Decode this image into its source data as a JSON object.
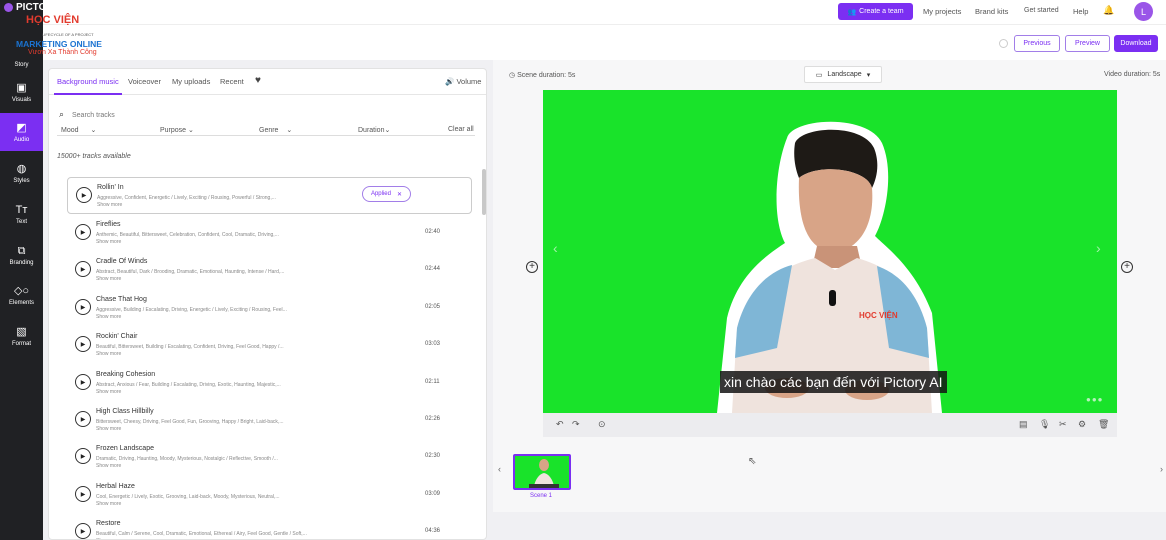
{
  "brand": {
    "logo_text": "PICTORY",
    "logo_sub": "LIFECYCLE OF A PROJECT",
    "watermark_line1": "HỌC VIỆN",
    "watermark_line2": "MARKETING ONLINE",
    "watermark_line3": "Vươn Xa Thành Công"
  },
  "rail": {
    "items": [
      {
        "label": "Story",
        "icon": "story-icon"
      },
      {
        "label": "Visuals",
        "icon": "image-icon"
      },
      {
        "label": "Audio",
        "icon": "music-icon"
      },
      {
        "label": "Styles",
        "icon": "palette-icon"
      },
      {
        "label": "Text",
        "icon": "text-icon"
      },
      {
        "label": "Branding",
        "icon": "branding-icon"
      },
      {
        "label": "Elements",
        "icon": "shapes-icon"
      },
      {
        "label": "Format",
        "icon": "format-icon"
      }
    ],
    "active": "Audio"
  },
  "topbar": {
    "create_team": "Create a team",
    "my_projects": "My projects",
    "brand_kits": "Brand kits",
    "get_started": "Get started",
    "help": "Help",
    "avatar_letter": "L"
  },
  "subbar": {
    "previous": "Previous",
    "preview": "Preview",
    "download": "Download"
  },
  "audio": {
    "tabs": [
      "Background music",
      "Voiceover",
      "My uploads",
      "Recent"
    ],
    "volume": "Volume",
    "search_placeholder": "Search tracks",
    "filters": [
      "Mood",
      "Purpose",
      "Genre",
      "Duration"
    ],
    "clear_all": "Clear all",
    "count": "15000+ tracks available",
    "show_more": "Show more",
    "applied_label": "Applied",
    "tracks": [
      {
        "title": "Rollin' In",
        "tags": "Aggressive, Confident, Energetic / Lively, Exciting / Rousing, Powerful / Strong,...",
        "duration": "",
        "applied": true
      },
      {
        "title": "Fireflies",
        "tags": "Anthemic, Beautiful, Bittersweet, Celebration, Confident, Cool, Dramatic, Driving,...",
        "duration": "02:40"
      },
      {
        "title": "Cradle Of Winds",
        "tags": "Abstract, Beautiful, Dark / Brooding, Dramatic, Emotional, Haunting, Intense / Hard,...",
        "duration": "02:44"
      },
      {
        "title": "Chase That Hog",
        "tags": "Aggressive, Building / Escalating, Driving, Energetic / Lively, Exciting / Rousing, Feel...",
        "duration": "02:05"
      },
      {
        "title": "Rockin' Chair",
        "tags": "Beautiful, Bittersweet, Building / Escalating, Confident, Driving, Feel Good, Happy /...",
        "duration": "03:03"
      },
      {
        "title": "Breaking Cohesion",
        "tags": "Abstract, Anxious / Fear, Building / Escalating, Driving, Exotic, Haunting, Majestic,...",
        "duration": "02:11"
      },
      {
        "title": "High Class Hillbilly",
        "tags": "Bittersweet, Cheesy, Driving, Feel Good, Fun, Grooving, Happy / Bright, Laid-back,...",
        "duration": "02:26"
      },
      {
        "title": "Frozen Landscape",
        "tags": "Dramatic, Driving, Haunting, Moody, Mysterious, Nostalgic / Reflective, Smooth /...",
        "duration": "02:30"
      },
      {
        "title": "Herbal Haze",
        "tags": "Cool, Energetic / Lively, Exotic, Grooving, Laid-back, Moody, Mysterious, Neutral,...",
        "duration": "03:09"
      },
      {
        "title": "Restore",
        "tags": "Beautiful, Calm / Serene, Cool, Dramatic, Emotional, Ethereal / Airy, Feel Good, Gentle / Soft,...",
        "duration": "04:36"
      }
    ]
  },
  "editor": {
    "scene_duration": "Scene duration: 5s",
    "orientation": "Landscape",
    "video_duration": "Video duration: 5s",
    "caption": "xin chào các bạn đến với Pictory AI",
    "shirt_text": "HỌC VIỆN",
    "scene_label": "Scene 1",
    "canvas_color": "#19e32a",
    "accent": "#7b2ff2"
  }
}
